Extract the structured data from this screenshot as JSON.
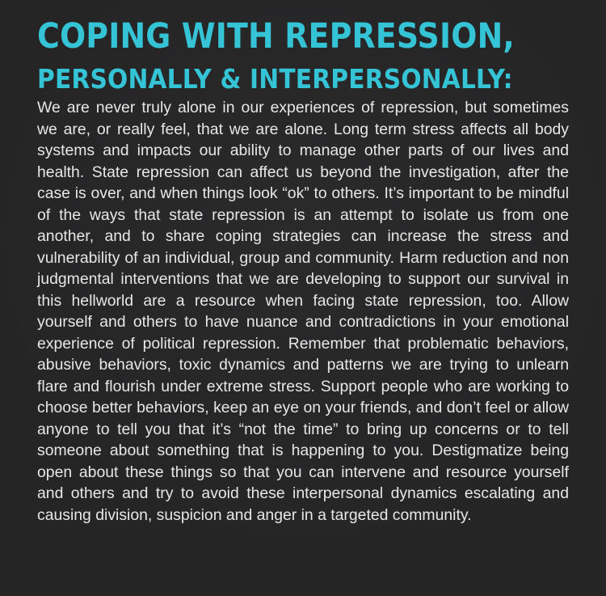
{
  "heading": {
    "line1": "COPING WITH REPRESSION,",
    "line2": "PERSONALLY & INTERPERSONALLY:"
  },
  "content": {
    "paragraph": "We are never truly alone in our experiences of repression, but sometimes we are, or really feel, that we are alone. Long term stress affects all body systems and impacts our ability to manage other parts of our lives and health. State repression can affect us beyond the investigation, after the case is over, and when things look “ok” to others. It’s important to be mindful of the ways that state repression is an attempt to isolate us from one another, and to share coping strategies can increase the stress and vulnerability of an individual, group and community. Harm reduction and non judgmental interventions that we are developing to support our survival in this hellworld are a resource when facing state repression, too. Allow yourself and others to have nuance and contradictions in your emotional experience of political repression. Remember that problematic behaviors, abusive behaviors, toxic dynamics and patterns we are trying to unlearn flare and flourish under extreme stress. Support people who are working to choose better behaviors, keep an eye on your friends, and don’t feel or allow anyone to tell you that it’s “not the time” to bring up concerns or to tell someone about something that is happening to you. Destigmatize being open about these things so that you can intervene and resource yourself and others and try to avoid these interpersonal dynamics escalating and causing division, suspicion and anger in a targeted community."
  },
  "colors": {
    "background": "#252526",
    "heading": "#35c3d6",
    "body_text": "#e7e7e7"
  }
}
